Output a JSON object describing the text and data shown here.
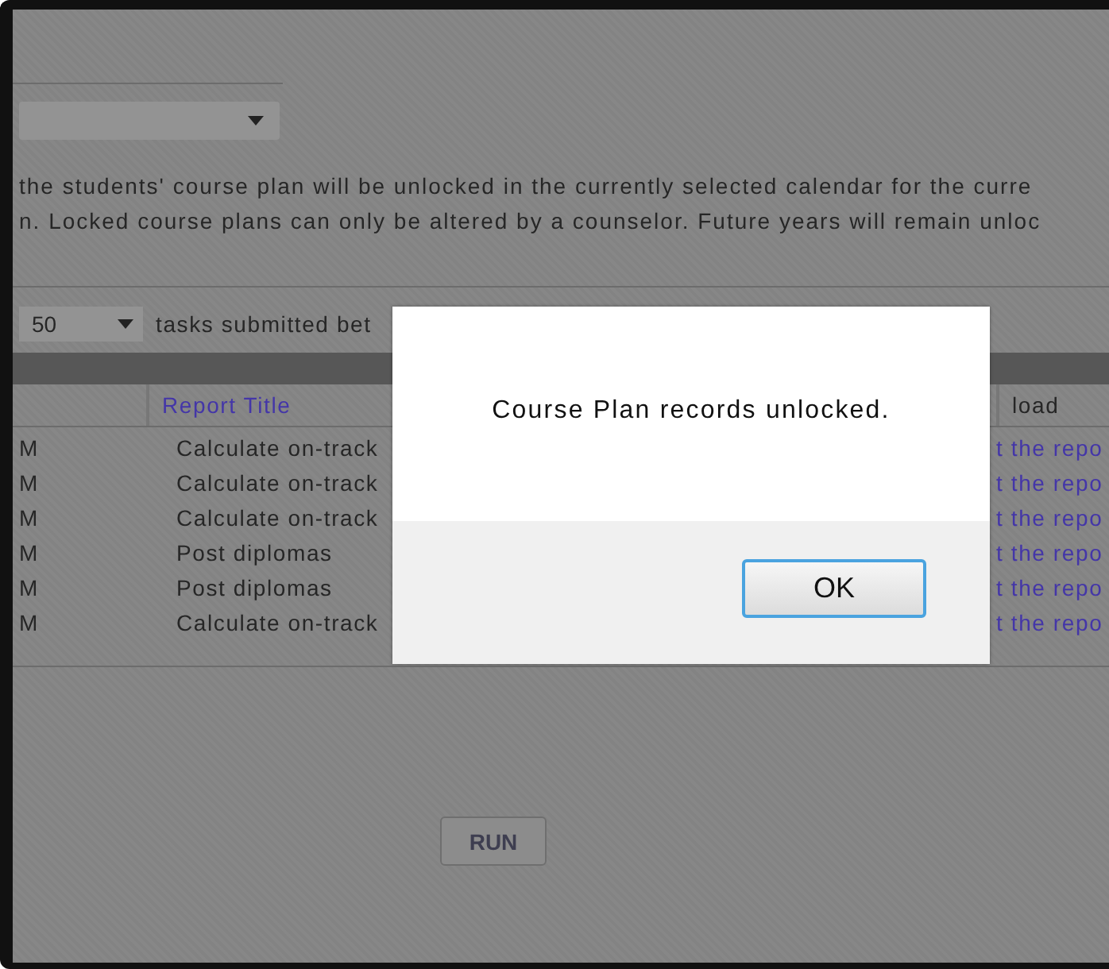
{
  "calendar_dropdown": {
    "open": false
  },
  "notice": [
    "the students' course plan will be unlocked in the currently selected calendar for the curre",
    "n. Locked course plans can only be altered by a counselor. Future years will remain unloc"
  ],
  "page_size": {
    "value": "50"
  },
  "filter_label": "tasks submitted bet",
  "table": {
    "columns": [
      {
        "label": "Report Title",
        "kind": "link"
      },
      {
        "label": "load",
        "kind": "plain"
      }
    ],
    "rows": [
      {
        "column_1": "M",
        "report_title": "Calculate on-track",
        "column_3": "t the repo"
      },
      {
        "column_1": "M",
        "report_title": "Calculate on-track",
        "column_3": "t the repo"
      },
      {
        "column_1": "M",
        "report_title": "Calculate on-track",
        "column_3": "t the repo"
      },
      {
        "column_1": "M",
        "report_title": "Post diplomas",
        "column_3": "t the repo"
      },
      {
        "column_1": "M",
        "report_title": "Post diplomas",
        "column_3": "t the repo"
      },
      {
        "column_1": "M",
        "report_title": "Calculate on-track",
        "column_3": "t the repo"
      }
    ]
  },
  "run_button": {
    "label": "RUN",
    "disabled": true
  },
  "dialog": {
    "message": "Course Plan records unlocked.",
    "buttons": [
      {
        "label": "OK",
        "focused": true
      }
    ]
  }
}
